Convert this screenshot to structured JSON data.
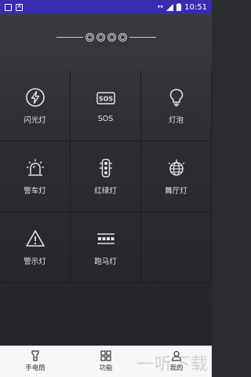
{
  "status_bar": {
    "time": "10:51",
    "left_icons": [
      "notification-icon",
      "text-icon"
    ],
    "right_icons": [
      "data-transfer-icon",
      "signal-icon",
      "battery-icon"
    ]
  },
  "grid": {
    "items": [
      {
        "label": "闪光灯",
        "icon": "lightning-icon"
      },
      {
        "label": "SOS",
        "icon": "sos-icon"
      },
      {
        "label": "灯泡",
        "icon": "bulb-icon"
      },
      {
        "label": "警车灯",
        "icon": "siren-icon"
      },
      {
        "label": "红绿灯",
        "icon": "traffic-light-icon"
      },
      {
        "label": "舞厅灯",
        "icon": "disco-ball-icon"
      },
      {
        "label": "警示灯",
        "icon": "warning-icon"
      },
      {
        "label": "跑马灯",
        "icon": "marquee-icon"
      }
    ],
    "sos_icon_text": "SOS"
  },
  "tabbar": {
    "tabs": [
      {
        "label": "手电筒",
        "icon": "flashlight-icon"
      },
      {
        "label": "功能",
        "icon": "function-icon"
      },
      {
        "label": "我的",
        "icon": "user-icon"
      }
    ]
  },
  "watermark": "一听下载"
}
